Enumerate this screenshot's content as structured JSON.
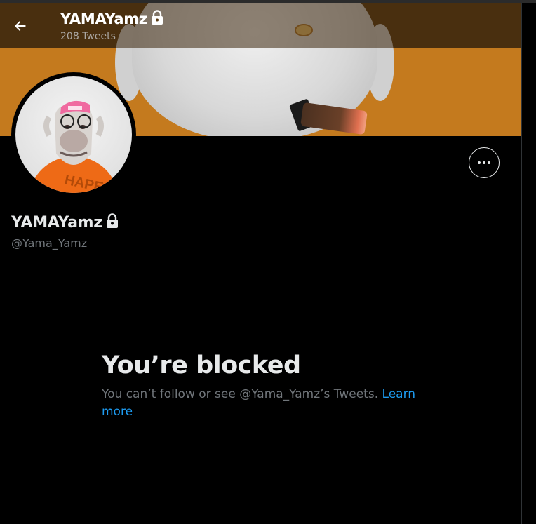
{
  "header": {
    "back_icon": "arrow-left-icon",
    "name": "YAMAYamz",
    "tweet_count": "208 Tweets",
    "lock_icon": "lock-icon"
  },
  "profile": {
    "name": "YAMAYamz",
    "handle": "@Yama_Yamz",
    "lock_icon": "lock-icon",
    "more_icon": "more-horizontal-icon"
  },
  "blocked": {
    "title": "You’re blocked",
    "message": "You can’t follow or see @Yama_Yamz’s Tweets.",
    "learn_more": "Learn more"
  },
  "colors": {
    "background": "#000000",
    "banner_orange": "#c47a1e",
    "text_primary": "#e7e9ea",
    "text_secondary": "#71767b",
    "link": "#1d9bf0"
  }
}
